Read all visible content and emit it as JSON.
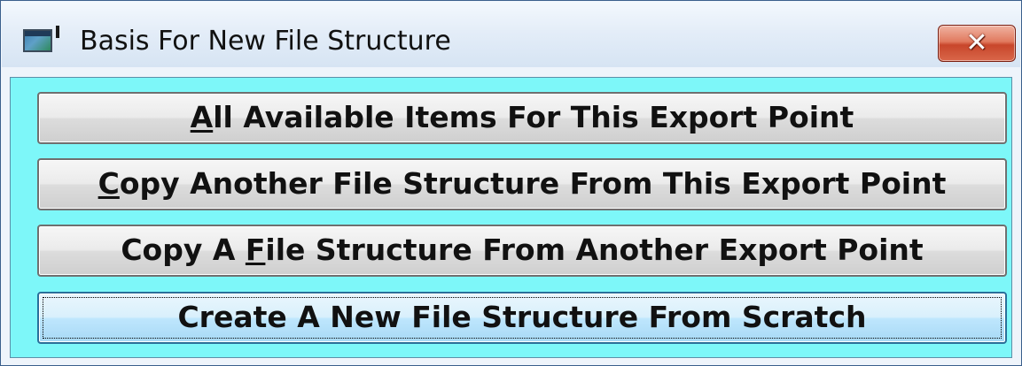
{
  "window": {
    "title": "Basis For New File Structure",
    "icon": "app-window-icon",
    "close_glyph": "✕"
  },
  "buttons": [
    {
      "pre": "",
      "accel": "A",
      "post": "ll Available Items For This Export Point"
    },
    {
      "pre": "",
      "accel": "C",
      "post": "opy Another File Structure From This Export Point"
    },
    {
      "pre": "Copy A ",
      "accel": "F",
      "post": "ile Structure From Another Export Point"
    },
    {
      "pre": "Create A New File Structure From Scratch",
      "accel": "",
      "post": ""
    }
  ],
  "colors": {
    "client_background": "#7df7f9",
    "title_bar": "#dbe6f4",
    "close_button": "#d9674a"
  }
}
